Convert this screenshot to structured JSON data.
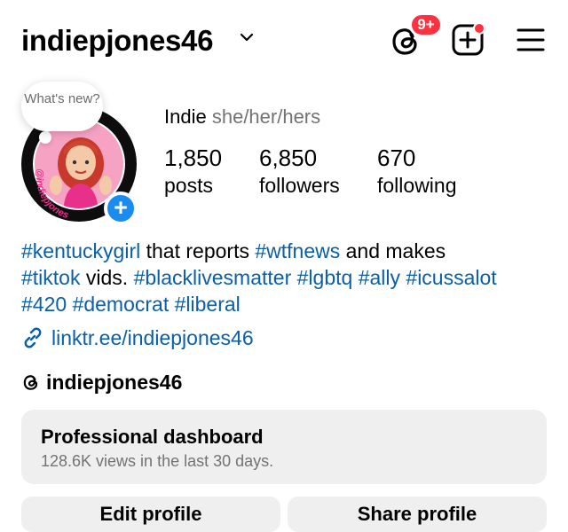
{
  "header": {
    "username": "indiepjones46",
    "notification_badge": "9+",
    "icons": [
      "chevron-down-icon",
      "threads-icon",
      "create-icon",
      "menu-icon"
    ]
  },
  "profile": {
    "note": "What's new?",
    "avatar_label": "@indiepjones",
    "display_name": "Indie",
    "pronouns": "she/her/hers",
    "stats": [
      {
        "value": "1,850",
        "label": "posts"
      },
      {
        "value": "6,850",
        "label": "followers"
      },
      {
        "value": "670",
        "label": "following"
      }
    ]
  },
  "bio": {
    "tag1": "#kentuckygirl",
    "text1": " that reports ",
    "tag2": "#wtfnews",
    "text2": " and makes",
    "tag3": "#tiktok",
    "text3": " vids. ",
    "tag4": "#blacklivesmatter",
    "tag5": "#lgbtq",
    "tag6": "#ally",
    "tag7": "#icussalot",
    "tag8": "#420",
    "tag9": "#democrat",
    "tag10": "#liberal"
  },
  "link": "linktr.ee/indiepjones46",
  "threads_handle": "indiepjones46",
  "dashboard": {
    "title": "Professional dashboard",
    "subtitle": "128.6K views in the last 30 days."
  },
  "buttons": {
    "edit": "Edit profile",
    "share": "Share profile"
  },
  "colors": {
    "accent": "#0a5fa8",
    "badge": "#ff3040",
    "add_button": "#1a8cf0"
  }
}
